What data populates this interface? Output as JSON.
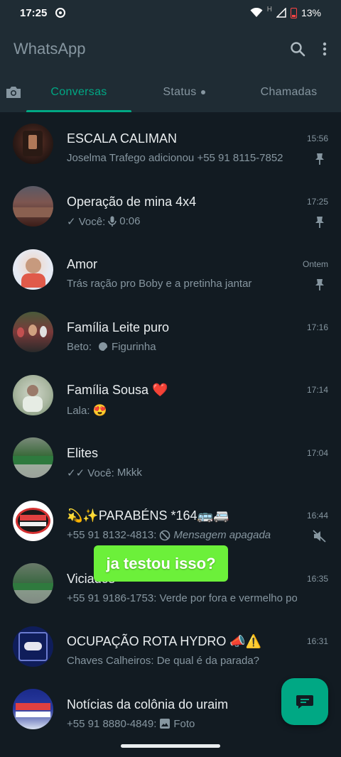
{
  "status_bar": {
    "time": "17:25",
    "battery": "13%",
    "network": "H"
  },
  "app_bar": {
    "title": "WhatsApp",
    "search_icon": "search-icon",
    "menu_icon": "more-vert-icon"
  },
  "tabs": [
    {
      "label": "Conversas",
      "selected": true
    },
    {
      "label": "Status",
      "has_dot": true
    },
    {
      "label": "Chamadas"
    }
  ],
  "chats": [
    {
      "name": "ESCALA CALIMAN",
      "time": "15:56",
      "preview": "Joselma Trafego adicionou +55 91 8115-7852",
      "icon": "pin-icon"
    },
    {
      "name": "Operação de mina 4x4",
      "time": "17:25",
      "preview_prefix": "✓ Você:",
      "preview": "0:06",
      "icon": "pin-icon"
    },
    {
      "name": "Amor",
      "time": "Ontem",
      "preview": "Trás ração pro Boby e a pretinha jantar",
      "icon": "pin-icon"
    },
    {
      "name": "Família Leite puro",
      "time": "17:16",
      "preview_prefix": "Beto:",
      "preview": "Figurinha"
    },
    {
      "name": "Família Sousa ❤️",
      "time": "17:14",
      "preview_prefix": "Lala:",
      "preview": "😍"
    },
    {
      "name": "Elites",
      "time": "17:04",
      "preview_prefix": "✓✓ Você:",
      "preview": "Mkkk"
    },
    {
      "name": "💫✨PARABÉNS *164🚌🚐",
      "time": "16:44",
      "preview_prefix": "+55 91 8132-4813:",
      "preview": "Mensagem apagada",
      "icon": "mute-icon"
    },
    {
      "name": "Viciados",
      "time": "16:35",
      "preview": "+55 91 9186-1753: Verde por fora e vermelho po…"
    },
    {
      "name": "OCUPAÇÃO ROTA HYDRO 📣⚠️",
      "time": "16:31",
      "preview": "Chaves Calheiros: De qual é da parada?"
    },
    {
      "name": "Notícias da colônia do uraim",
      "time": "",
      "preview_prefix": "+55 91 8880-4849:",
      "preview": "Foto"
    }
  ],
  "overlay": {
    "caption": "ja testou isso?"
  },
  "colors": {
    "accent": "#00a884",
    "background": "#121b22",
    "header": "#1f2c34",
    "caption_bg": "#6cf03a"
  }
}
